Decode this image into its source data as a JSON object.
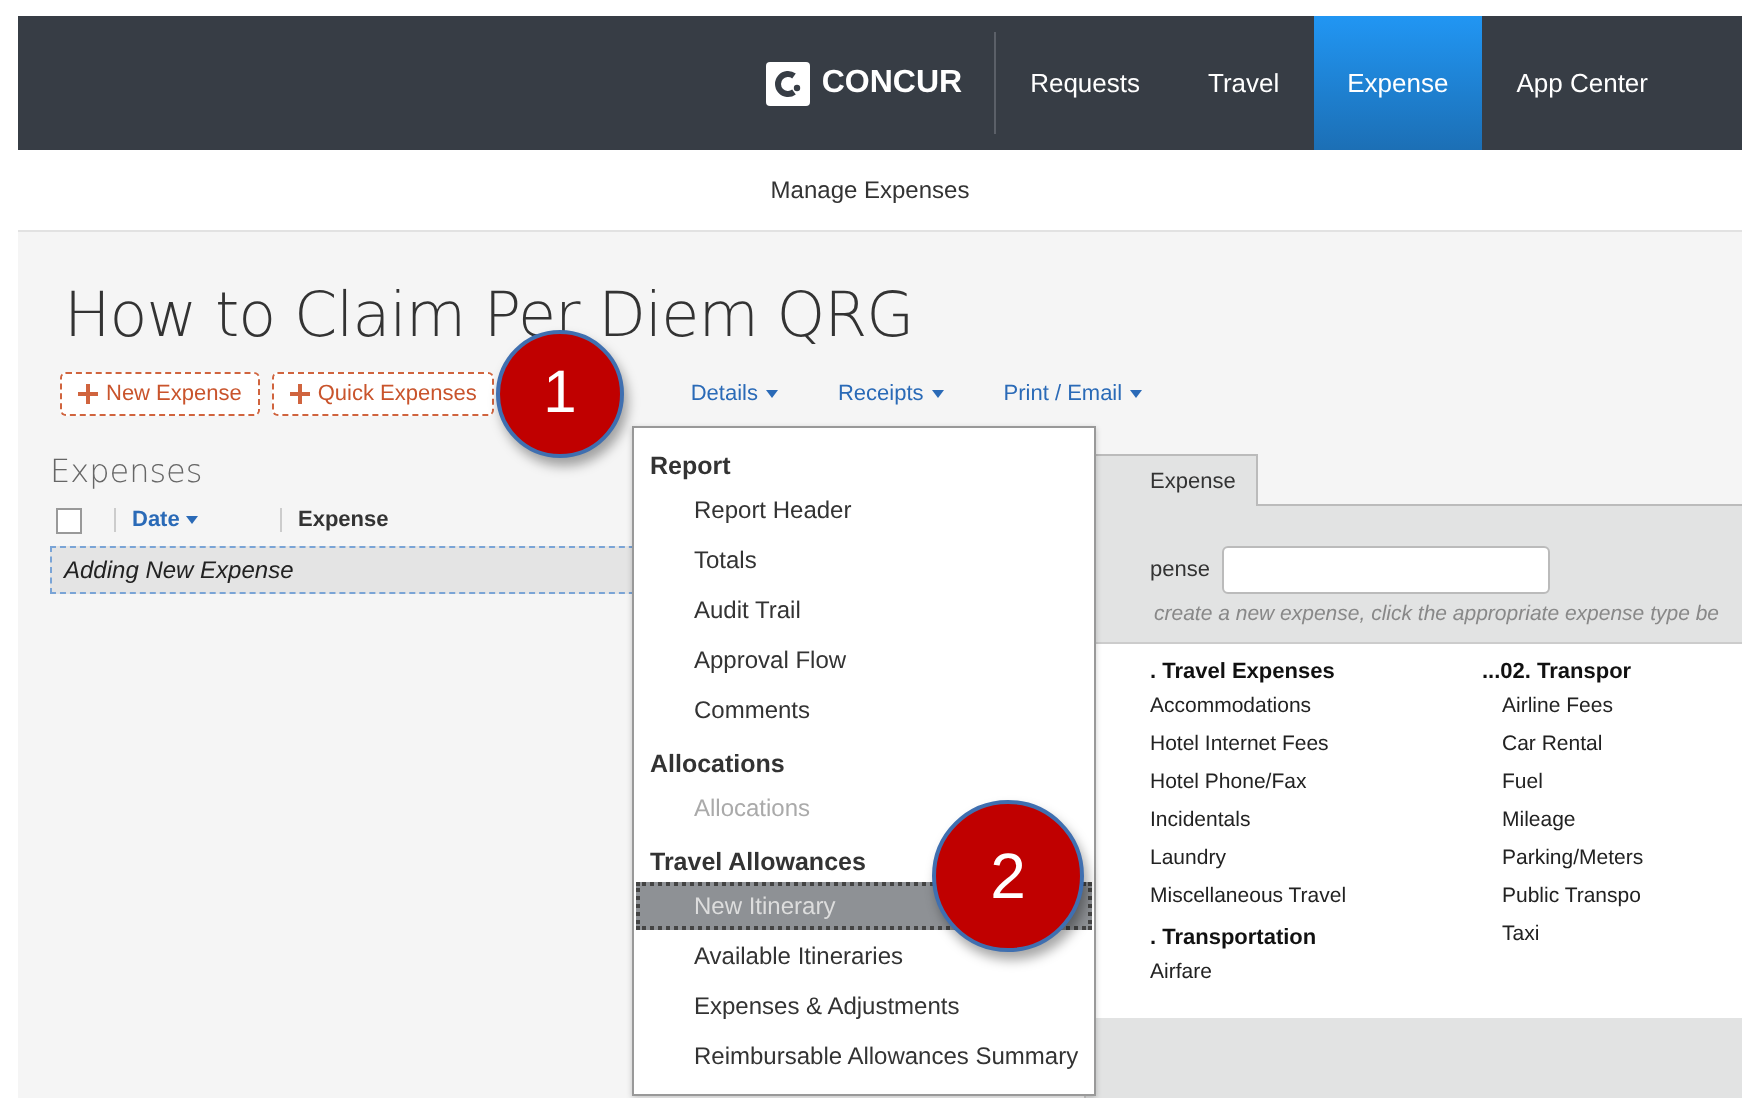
{
  "header": {
    "logo_text": "CONCUR",
    "nav": [
      {
        "label": "Requests",
        "selected": false
      },
      {
        "label": "Travel",
        "selected": false
      },
      {
        "label": "Expense",
        "selected": true
      },
      {
        "label": "App Center",
        "selected": false
      }
    ]
  },
  "subnav": {
    "label": "Manage Expenses"
  },
  "report": {
    "title": "How to Claim Per Diem QRG",
    "toolbar": [
      {
        "label": "New Expense",
        "kind": "add"
      },
      {
        "label": "Quick Expenses",
        "kind": "add"
      },
      {
        "label": "Details",
        "kind": "menu"
      },
      {
        "label": "Receipts",
        "kind": "menu"
      },
      {
        "label": "Print / Email",
        "kind": "menu"
      }
    ]
  },
  "expenses": {
    "heading": "Expenses",
    "columns": [
      {
        "label": "Date",
        "sortable": true
      },
      {
        "label": "Expense",
        "sortable": false
      }
    ],
    "select_all_checked": false,
    "rows": [
      {
        "text": "Adding New Expense"
      }
    ]
  },
  "new_expense_panel": {
    "tab": "Expense",
    "field_label": "pense",
    "hint": "create a new expense, click the appropriate expense type be",
    "groups": [
      {
        "title": ". Travel Expenses",
        "items": [
          "Accommodations",
          "Hotel Internet Fees",
          "Hotel Phone/Fax",
          "Incidentals",
          "Laundry",
          "Miscellaneous Travel"
        ]
      },
      {
        "title": ". Transportation",
        "items": [
          "Airfare"
        ]
      },
      {
        "title": "...02. Transpor",
        "items": [
          "Airline Fees",
          "Car Rental",
          "Fuel",
          "Mileage",
          "Parking/Meters",
          "Public Transpo",
          "Taxi"
        ]
      }
    ]
  },
  "details_menu": {
    "sections": [
      {
        "title": "Report",
        "items": [
          {
            "label": "Report Header",
            "disabled": false,
            "selected": false
          },
          {
            "label": "Totals",
            "disabled": false,
            "selected": false
          },
          {
            "label": "Audit Trail",
            "disabled": false,
            "selected": false
          },
          {
            "label": "Approval Flow",
            "disabled": false,
            "selected": false
          },
          {
            "label": "Comments",
            "disabled": false,
            "selected": false
          }
        ]
      },
      {
        "title": "Allocations",
        "items": [
          {
            "label": "Allocations",
            "disabled": true,
            "selected": false
          }
        ]
      },
      {
        "title": "Travel Allowances",
        "items": [
          {
            "label": "New Itinerary",
            "disabled": false,
            "selected": true
          },
          {
            "label": "Available Itineraries",
            "disabled": false,
            "selected": false
          },
          {
            "label": "Expenses & Adjustments",
            "disabled": false,
            "selected": false
          },
          {
            "label": "Reimbursable Allowances Summary",
            "disabled": false,
            "selected": false
          }
        ]
      }
    ]
  },
  "callouts": [
    "1",
    "2"
  ]
}
